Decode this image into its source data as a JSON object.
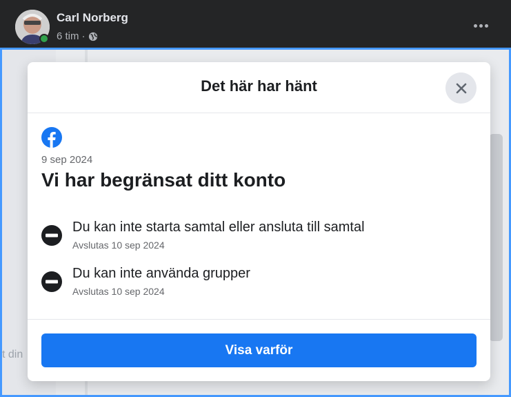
{
  "post": {
    "author": "Carl Norberg",
    "time": "6 tim",
    "separator": "·",
    "visibility_icon": "globe-icon"
  },
  "background": {
    "hint_text": "t din"
  },
  "dialog": {
    "title": "Det här har hänt",
    "close_icon": "close-icon",
    "logo_icon": "facebook-logo-icon",
    "date": "9 sep 2024",
    "heading": "Vi har begränsat ditt konto",
    "restrictions": [
      {
        "icon": "no-entry-icon",
        "text": "Du kan inte starta samtal eller ansluta till samtal",
        "ends": "Avslutas 10 sep 2024"
      },
      {
        "icon": "no-entry-icon",
        "text": "Du kan inte använda grupper",
        "ends": "Avslutas 10 sep 2024"
      }
    ],
    "button_label": "Visa varför"
  },
  "colors": {
    "brand": "#1877f2",
    "online": "#31a24c",
    "header_bg": "#242526"
  }
}
